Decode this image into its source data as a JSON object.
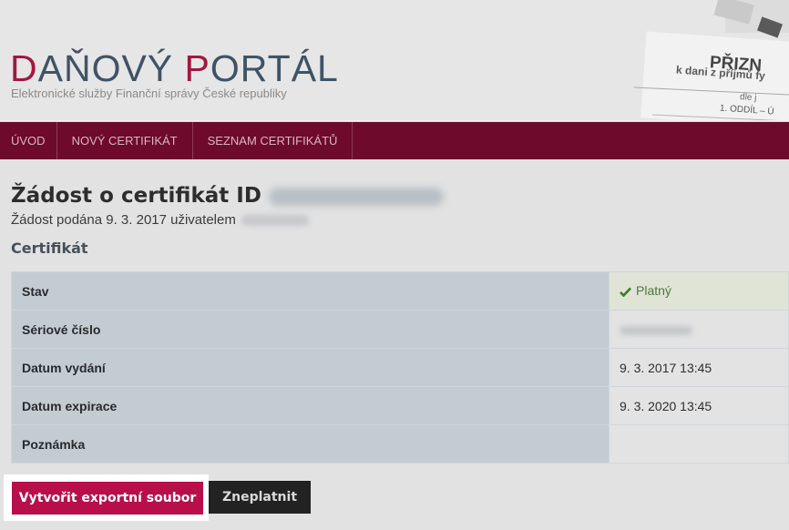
{
  "header": {
    "title_first_letter_1": "D",
    "title_part_1": "AŇOVÝ ",
    "title_first_letter_2": "P",
    "title_part_2": "ORTÁL",
    "subtitle": "Elektronické služby Finanční správy České republiky",
    "decoration": {
      "form_title": "PŘIZN",
      "form_line_1": "k dani z příjmů fy",
      "form_line_2": "dle j",
      "form_line_3": "1. ODDÍL – Ú"
    }
  },
  "nav": {
    "items": [
      {
        "label": "ÚVOD"
      },
      {
        "label": "NOVÝ CERTIFIKÁT"
      },
      {
        "label": "SEZNAM CERTIFIKÁTŮ"
      }
    ]
  },
  "request": {
    "title_prefix": "Žádost o certifikát ID",
    "submitted_prefix": "Žádost podána 9. 3. 2017 uživatelem"
  },
  "certificate": {
    "section_title": "Certifikát",
    "rows": [
      {
        "label": "Stav",
        "value": "Platný"
      },
      {
        "label": "Sériové číslo",
        "value": ""
      },
      {
        "label": "Datum vydání",
        "value": "9. 3. 2017 13:45"
      },
      {
        "label": "Datum expirace",
        "value": "9. 3. 2020 13:45"
      },
      {
        "label": "Poznámka",
        "value": ""
      }
    ],
    "status_color": "#4f7a3a"
  },
  "actions": {
    "export_label": "Vytvořit exportní soubor",
    "revoke_label": "Zneplatnit"
  },
  "colors": {
    "brand": "#a3173f",
    "nav_bg": "#6e0a2c",
    "primary_button": "#b80f4b",
    "secondary_button": "#222222"
  }
}
